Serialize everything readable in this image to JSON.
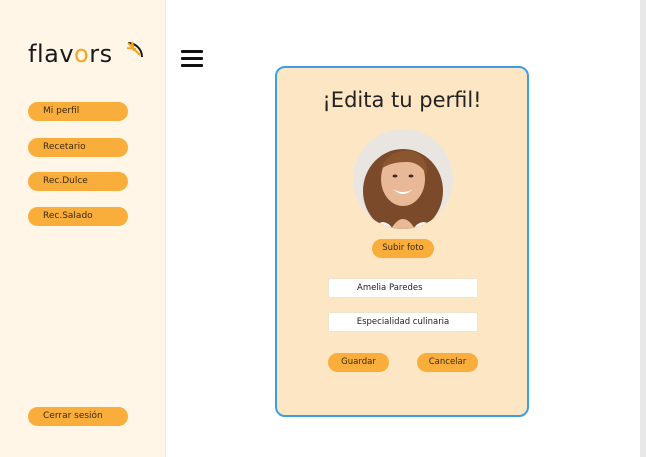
{
  "app": {
    "logo_text": "flav",
    "logo_o": "o",
    "logo_rest": "rs"
  },
  "sidebar": {
    "items": [
      {
        "label": "Mi perfil"
      },
      {
        "label": "Recetario"
      },
      {
        "label": "Rec.Dulce"
      },
      {
        "label": "Rec.Salado"
      }
    ],
    "logout_label": "Cerrar sesión"
  },
  "header": {
    "menu_icon": "hamburger-icon"
  },
  "profile_card": {
    "title": "¡Edita tu perfil!",
    "avatar": "profile-photo",
    "upload_label": "Subir foto",
    "name_value": "Amelia Paredes",
    "specialty_placeholder": "Especialidad culinaria",
    "save_label": "Guardar",
    "cancel_label": "Cancelar"
  },
  "colors": {
    "accent": "#f9ad3a",
    "card_bg": "#fde6c3",
    "card_border": "#3b9ee6",
    "sidebar_bg": "#fff6e8"
  }
}
